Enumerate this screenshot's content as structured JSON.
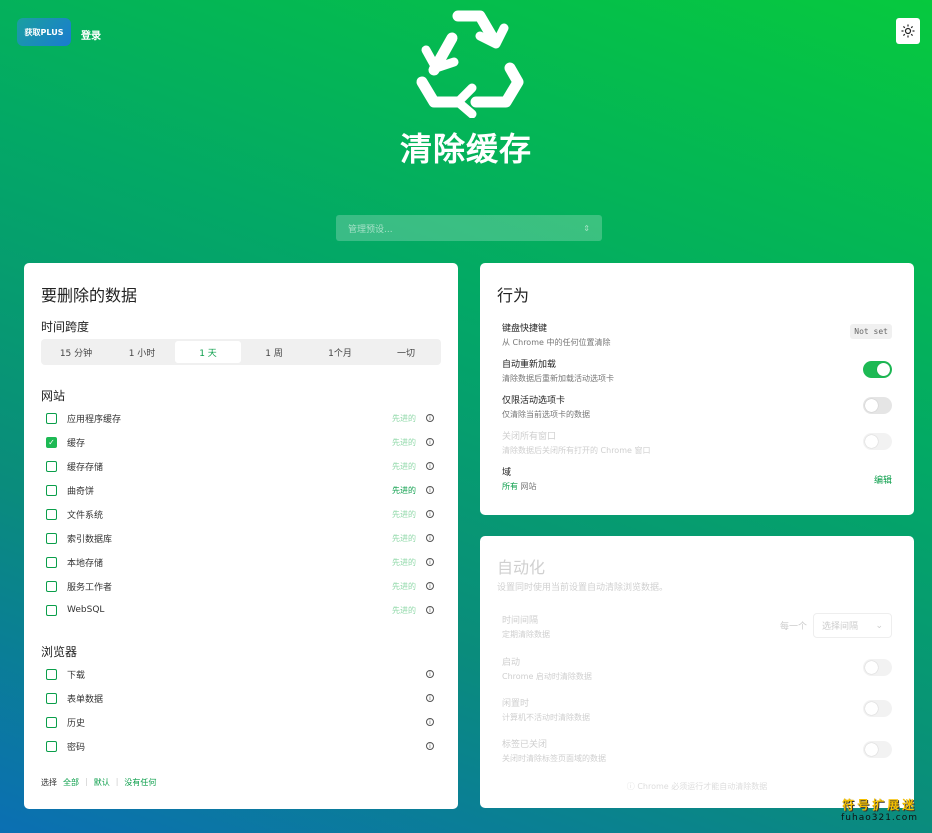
{
  "header": {
    "logo_text": "获取PLUS",
    "login": "登录",
    "title": "清除缓存",
    "preset_placeholder": "管理预设..."
  },
  "data_card": {
    "title": "要删除的数据",
    "timespan_label": "时间跨度",
    "timespans": [
      "15 分钟",
      "1 小时",
      "1 天",
      "1 周",
      "1个月",
      "一切"
    ],
    "active_timespan": "1 天",
    "website_label": "网站",
    "website_items": [
      {
        "label": "应用程序缓存",
        "checked": false,
        "advanced": "先进的",
        "strong": false
      },
      {
        "label": "缓存",
        "checked": true,
        "advanced": "先进的",
        "strong": false
      },
      {
        "label": "缓存存储",
        "checked": false,
        "advanced": "先进的",
        "strong": false
      },
      {
        "label": "曲奇饼",
        "checked": false,
        "advanced": "先进的",
        "strong": true
      },
      {
        "label": "文件系统",
        "checked": false,
        "advanced": "先进的",
        "strong": false
      },
      {
        "label": "索引数据库",
        "checked": false,
        "advanced": "先进的",
        "strong": false
      },
      {
        "label": "本地存储",
        "checked": false,
        "advanced": "先进的",
        "strong": false
      },
      {
        "label": "服务工作者",
        "checked": false,
        "advanced": "先进的",
        "strong": false
      },
      {
        "label": "WebSQL",
        "checked": false,
        "advanced": "先进的",
        "strong": false
      }
    ],
    "browser_label": "浏览器",
    "browser_items": [
      {
        "label": "下载",
        "checked": false
      },
      {
        "label": "表单数据",
        "checked": false
      },
      {
        "label": "历史",
        "checked": false
      },
      {
        "label": "密码",
        "checked": false
      }
    ],
    "select_label": "选择",
    "select_all": "全部",
    "select_default": "默认",
    "select_none": "没有任何"
  },
  "behavior_card": {
    "title": "行为",
    "shortcut_title": "键盘快捷键",
    "shortcut_sub": "从 Chrome 中的任何位置清除",
    "shortcut_value": "Not set",
    "reload_title": "自动重新加载",
    "reload_sub": "清除数据后重新加载活动选项卡",
    "reload_on": true,
    "active_tab_title": "仅限活动选项卡",
    "active_tab_sub": "仅清除当前选项卡的数据",
    "active_tab_on": false,
    "close_windows_title": "关闭所有窗口",
    "close_windows_sub": "清除数据后关闭所有打开的 Chrome 窗口",
    "domain_title": "域",
    "domain_sub_green": "所有",
    "domain_sub_rest": "网站",
    "edit": "编辑"
  },
  "automation_card": {
    "title": "自动化",
    "desc": "设置同时使用当前设置自动清除浏览数据。",
    "interval_title": "时间间隔",
    "interval_sub": "定期清除数据",
    "interval_every": "每一个",
    "interval_placeholder": "选择间隔",
    "startup_title": "启动",
    "startup_sub": "Chrome 启动时清除数据",
    "idle_title": "闲置时",
    "idle_sub": "计算机不活动时清除数据",
    "tab_closed_title": "标签已关闭",
    "tab_closed_sub": "关闭时清除标签页面域的数据",
    "footer": "Chrome 必须运行才能自动清除数据"
  },
  "watermark": {
    "cn": "符号扩展迷",
    "en": "fuhao321.com"
  }
}
